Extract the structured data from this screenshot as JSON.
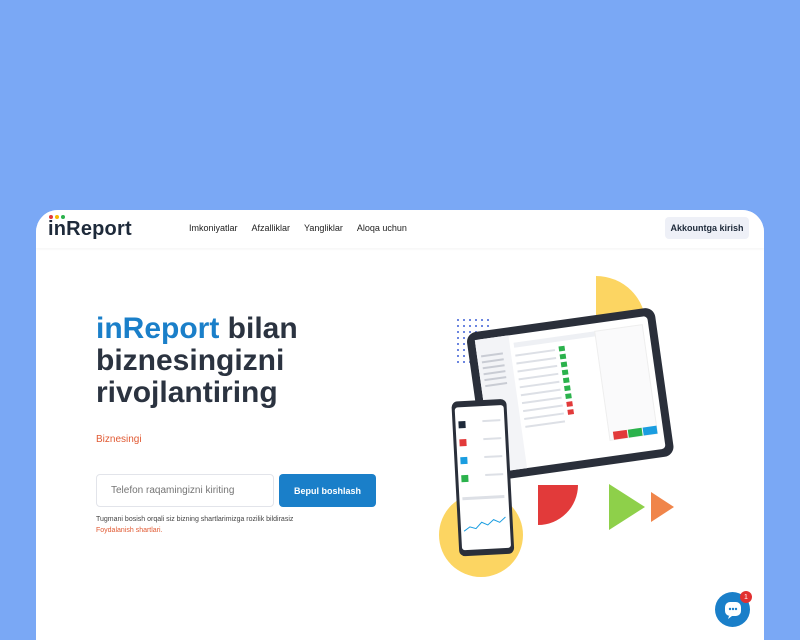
{
  "nav": {
    "logo": "inReport",
    "links": [
      "Imkoniyatlar",
      "Afzalliklar",
      "Yangliklar",
      "Aloqa uchun"
    ],
    "login": "Akkountga kirish"
  },
  "hero": {
    "title_brand": "inReport",
    "title_rest": " bilan biznesingizni rivojlantiring",
    "subtitle": "Biznesingi",
    "phone_placeholder": "Telefon raqamingizni kiriting",
    "cta": "Bepul boshlash",
    "terms_text": "Tugmani bosish orqali siz bizning shartlarimizga rozilik bildirasiz",
    "terms_link": "Foydalanish shartlari."
  },
  "chat": {
    "badge": "1"
  },
  "colors": {
    "background": "#7aa8f5",
    "accent": "#1a7fc9",
    "orange": "#e15a33"
  }
}
